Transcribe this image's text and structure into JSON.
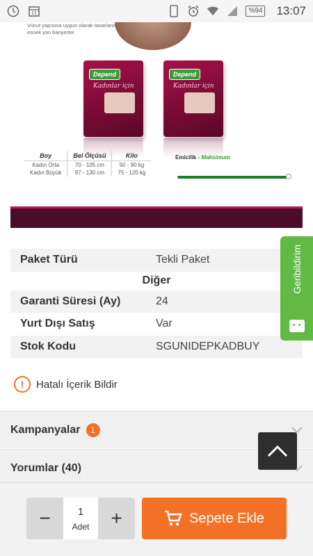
{
  "status_bar": {
    "time": "13:07",
    "battery": "%94",
    "icons": [
      "clock-icon",
      "calendar-icon",
      "phone-icon",
      "alarm-icon",
      "wifi-icon",
      "signal-icon"
    ]
  },
  "product_image": {
    "description_text": "Vücut yapısına uygun olarak tasarlanmış esnek yan bariyerler.",
    "pack_brand": "Depend",
    "pack_subtitle": "Kadınlar için",
    "spec_headers": [
      "Boy",
      "Bel Ölçüsü",
      "Kilo"
    ],
    "spec_rows": [
      [
        "Kadın Orta",
        "70 - 105 cm",
        "50 - 90 kg"
      ],
      [
        "Kadın Büyük",
        "97 - 130 cm",
        "75 - 120 kg"
      ]
    ],
    "absorbency_label": "Emicilik",
    "absorbency_value": "Maksimum"
  },
  "details": {
    "rows_top": [
      {
        "key": "Paket Türü",
        "value": "Tekli Paket"
      }
    ],
    "section_other": "Diğer",
    "rows_bottom": [
      {
        "key": "Garanti Süresi (Ay)",
        "value": "24"
      },
      {
        "key": "Yurt Dışı Satış",
        "value": "Var"
      },
      {
        "key": "Stok Kodu",
        "value": "SGUNIDEPKADBUY"
      }
    ]
  },
  "report_link": "Hatalı İçerik Bildir",
  "campaigns": {
    "label": "Kampanyalar",
    "badge": "1"
  },
  "reviews": {
    "label": "Yorumlar (40)"
  },
  "feedback_tab": "Geribildirim",
  "cart": {
    "quantity": "1",
    "unit": "Adet",
    "minus": "−",
    "plus": "+",
    "add_button": "Sepete Ekle"
  },
  "colors": {
    "accent": "#f27125",
    "feedback_green": "#63b945",
    "pack_magenta": "#a8104a"
  }
}
